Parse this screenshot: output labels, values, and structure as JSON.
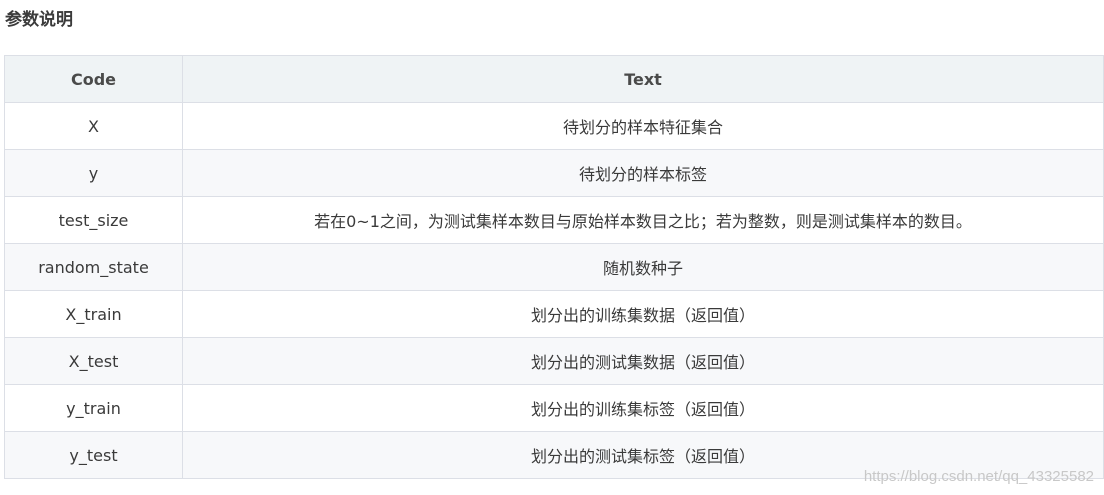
{
  "heading": "参数说明",
  "table": {
    "headers": [
      "Code",
      "Text"
    ],
    "rows": [
      {
        "code": "X",
        "text": "待划分的样本特征集合"
      },
      {
        "code": "y",
        "text": "待划分的样本标签"
      },
      {
        "code": "test_size",
        "text": "若在0~1之间，为测试集样本数目与原始样本数目之比；若为整数，则是测试集样本的数目。"
      },
      {
        "code": "random_state",
        "text": "随机数种子"
      },
      {
        "code": "X_train",
        "text": "划分出的训练集数据（返回值）"
      },
      {
        "code": "X_test",
        "text": "划分出的测试集数据（返回值）"
      },
      {
        "code": "y_train",
        "text": "划分出的训练集标签（返回值）"
      },
      {
        "code": "y_test",
        "text": "划分出的测试集标签（返回值）"
      }
    ]
  },
  "watermark": "https://blog.csdn.net/qq_43325582"
}
